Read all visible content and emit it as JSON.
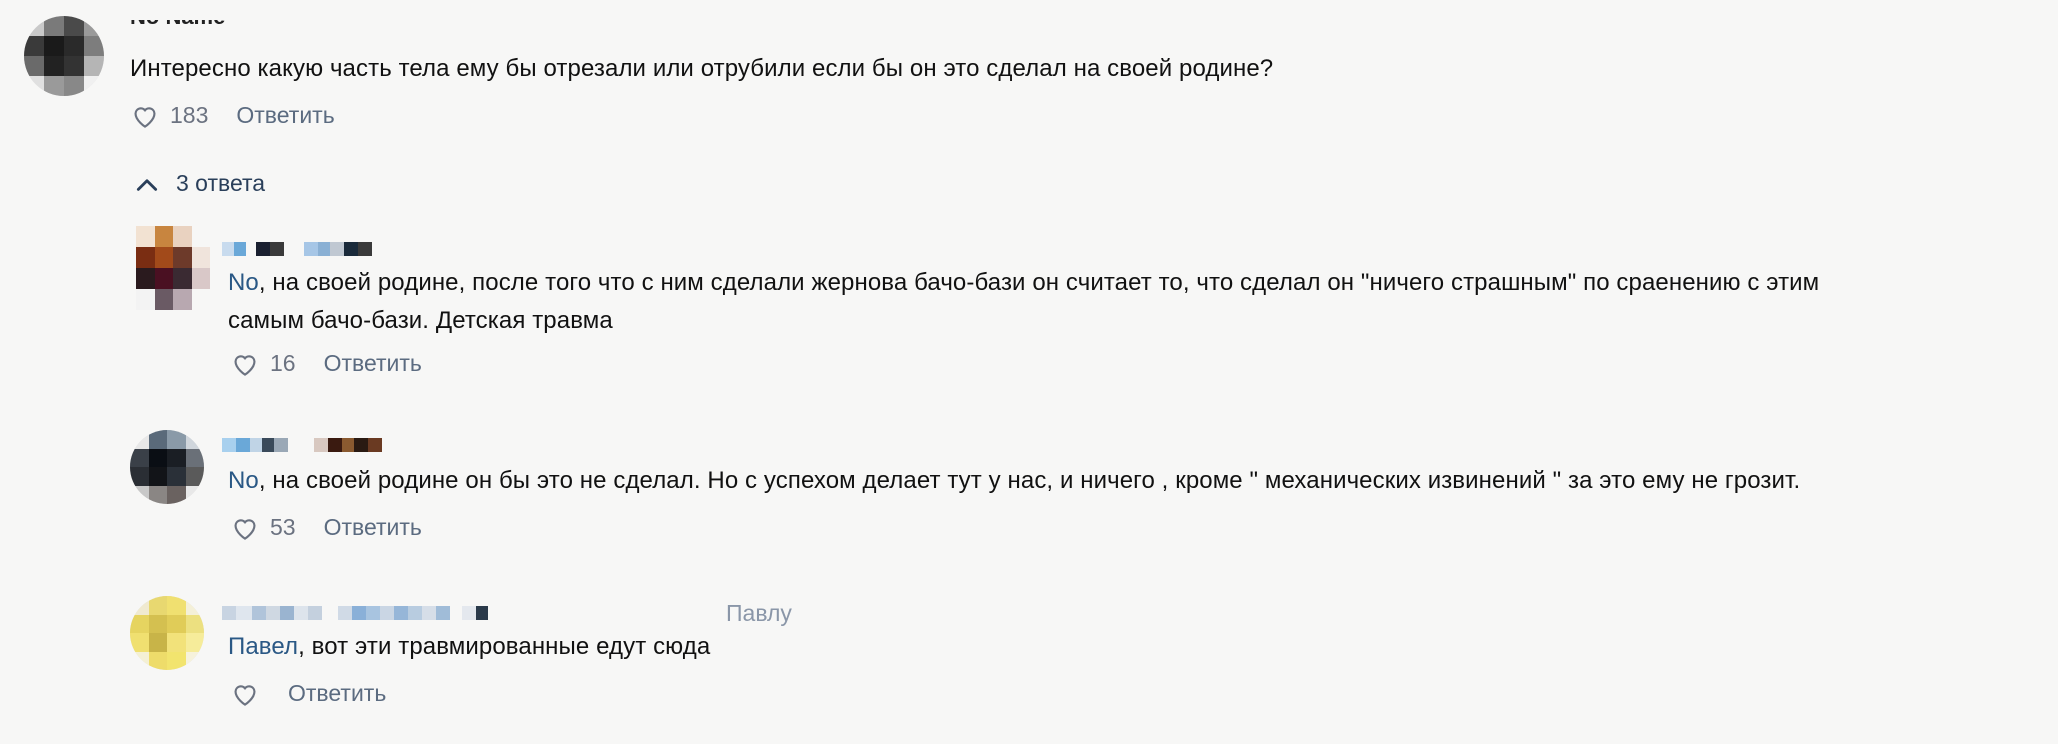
{
  "comments": [
    {
      "author": "No Name",
      "text": "Интересно какую часть тела ему бы отрезали или отрубили если бы он это сделал на своей родине?",
      "likes": "183",
      "reply_label": "Ответить"
    }
  ],
  "replies_toggle": {
    "label": "3 ответа",
    "icon": "chevron-up-icon"
  },
  "replies": [
    {
      "mention": "No",
      "text_line1": ", на своей родине, после того что с ним сделали жернова бачо-бази он считает то, что сделал он \"ничего страшным\" по сраенению с этим",
      "text_line2": "самым бачо-бази. Детская травма",
      "likes": "16",
      "reply_label": "Ответить"
    },
    {
      "mention": "No",
      "text_line1": ", на своей родине он бы это не сделал. Но с успехом делает тут у нас, и ничего , кроме \" механических извинений \" за это ему не грозит.",
      "likes": "53",
      "reply_label": "Ответить"
    },
    {
      "reply_to": "Павлу",
      "mention": "Павел",
      "text_line1": ", вот эти травмированные едут сюда",
      "reply_label": "Ответить"
    }
  ],
  "colors": {
    "accent": "#2a5885",
    "muted": "#6b7280",
    "background": "#f7f7f6"
  }
}
